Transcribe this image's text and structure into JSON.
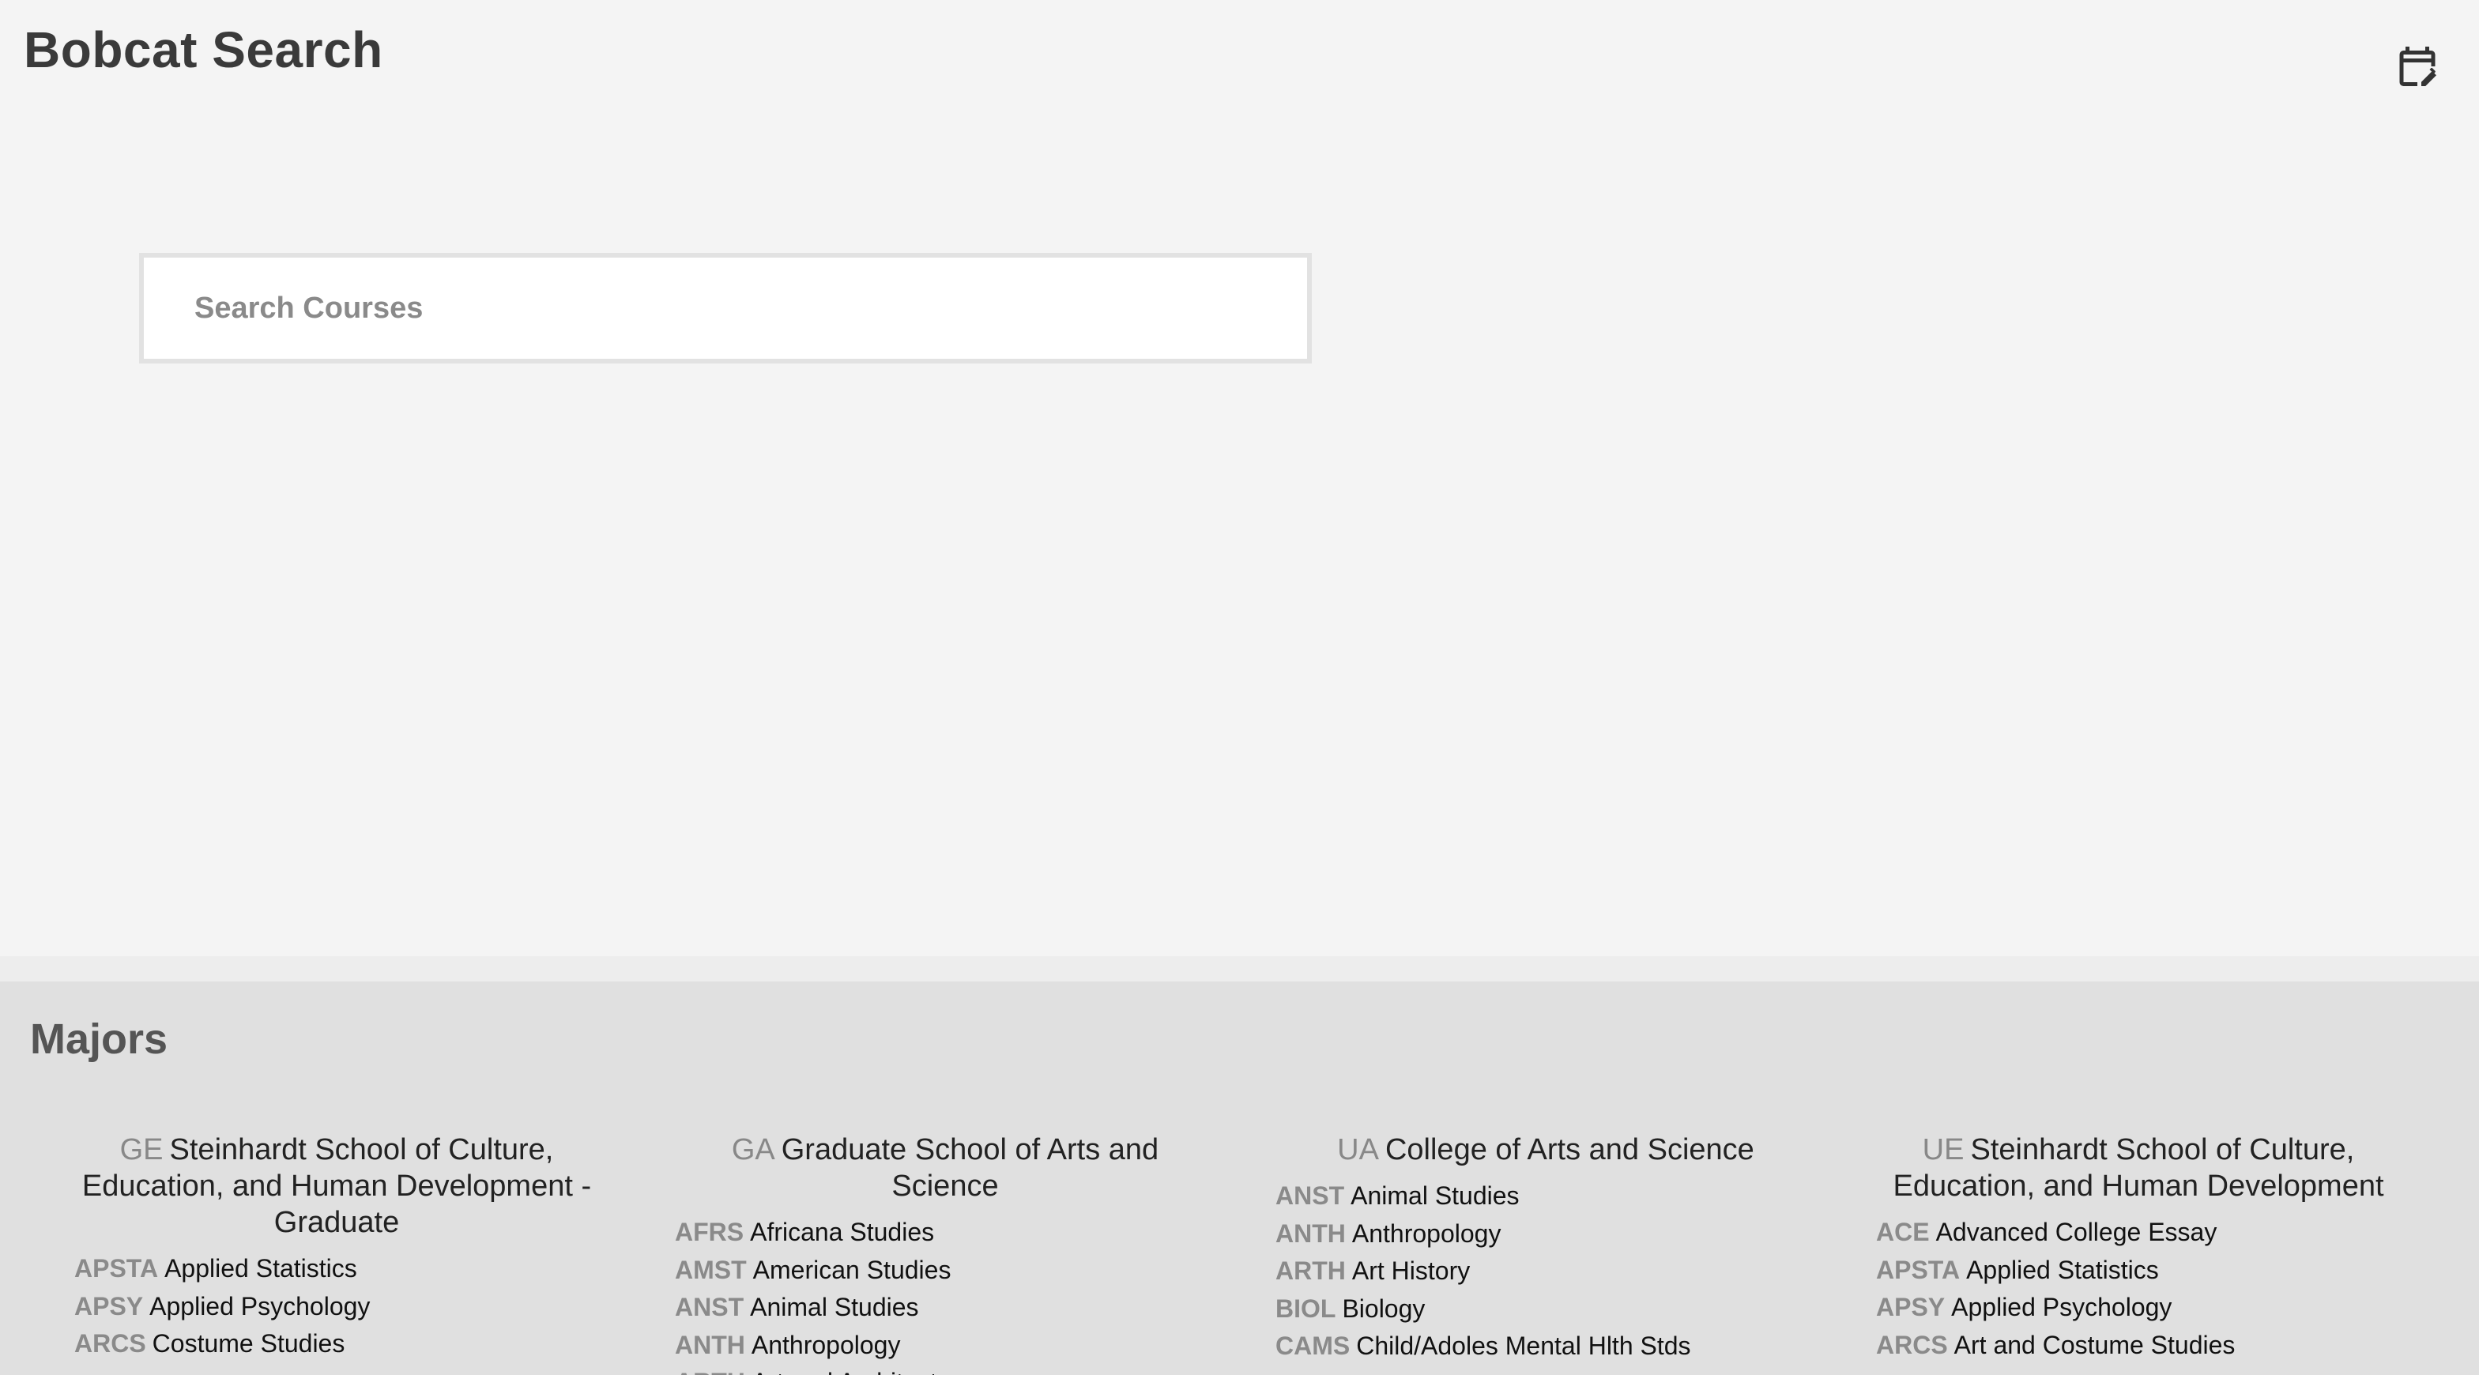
{
  "app": {
    "title": "Bobcat Search",
    "calendar_icon": "calendar-edit-icon"
  },
  "search": {
    "placeholder": "Search Courses",
    "value": ""
  },
  "majors": {
    "title": "Majors",
    "columns": [
      {
        "code": "GE",
        "name": "Steinhardt School of Culture, Education, and Human Development - Graduate",
        "items": [
          {
            "abbr": "APSTA",
            "name": "Applied Statistics"
          },
          {
            "abbr": "APSY",
            "name": "Applied Psychology"
          },
          {
            "abbr": "ARCS",
            "name": "Costume Studies"
          }
        ]
      },
      {
        "code": "GA",
        "name": "Graduate School of Arts and Science",
        "items": [
          {
            "abbr": "AFRS",
            "name": "Africana Studies"
          },
          {
            "abbr": "AMST",
            "name": "American Studies"
          },
          {
            "abbr": "ANST",
            "name": "Animal Studies"
          },
          {
            "abbr": "ANTH",
            "name": "Anthropology"
          },
          {
            "abbr": "ARTH",
            "name": "Art and Architecture"
          }
        ]
      },
      {
        "code": "UA",
        "name": "College of Arts and Science",
        "items": [
          {
            "abbr": "ANST",
            "name": "Animal Studies"
          },
          {
            "abbr": "ANTH",
            "name": "Anthropology"
          },
          {
            "abbr": "ARTH",
            "name": "Art History"
          },
          {
            "abbr": "BIOL",
            "name": "Biology"
          },
          {
            "abbr": "CAMS",
            "name": "Child/Adoles Mental Hlth Stds"
          }
        ]
      },
      {
        "code": "UE",
        "name": "Steinhardt School of Culture, Education, and Human Development",
        "items": [
          {
            "abbr": "ACE",
            "name": "Advanced College Essay"
          },
          {
            "abbr": "APSTA",
            "name": "Applied Statistics"
          },
          {
            "abbr": "APSY",
            "name": "Applied Psychology"
          },
          {
            "abbr": "ARCS",
            "name": "Art and Costume Studies"
          }
        ]
      }
    ]
  }
}
